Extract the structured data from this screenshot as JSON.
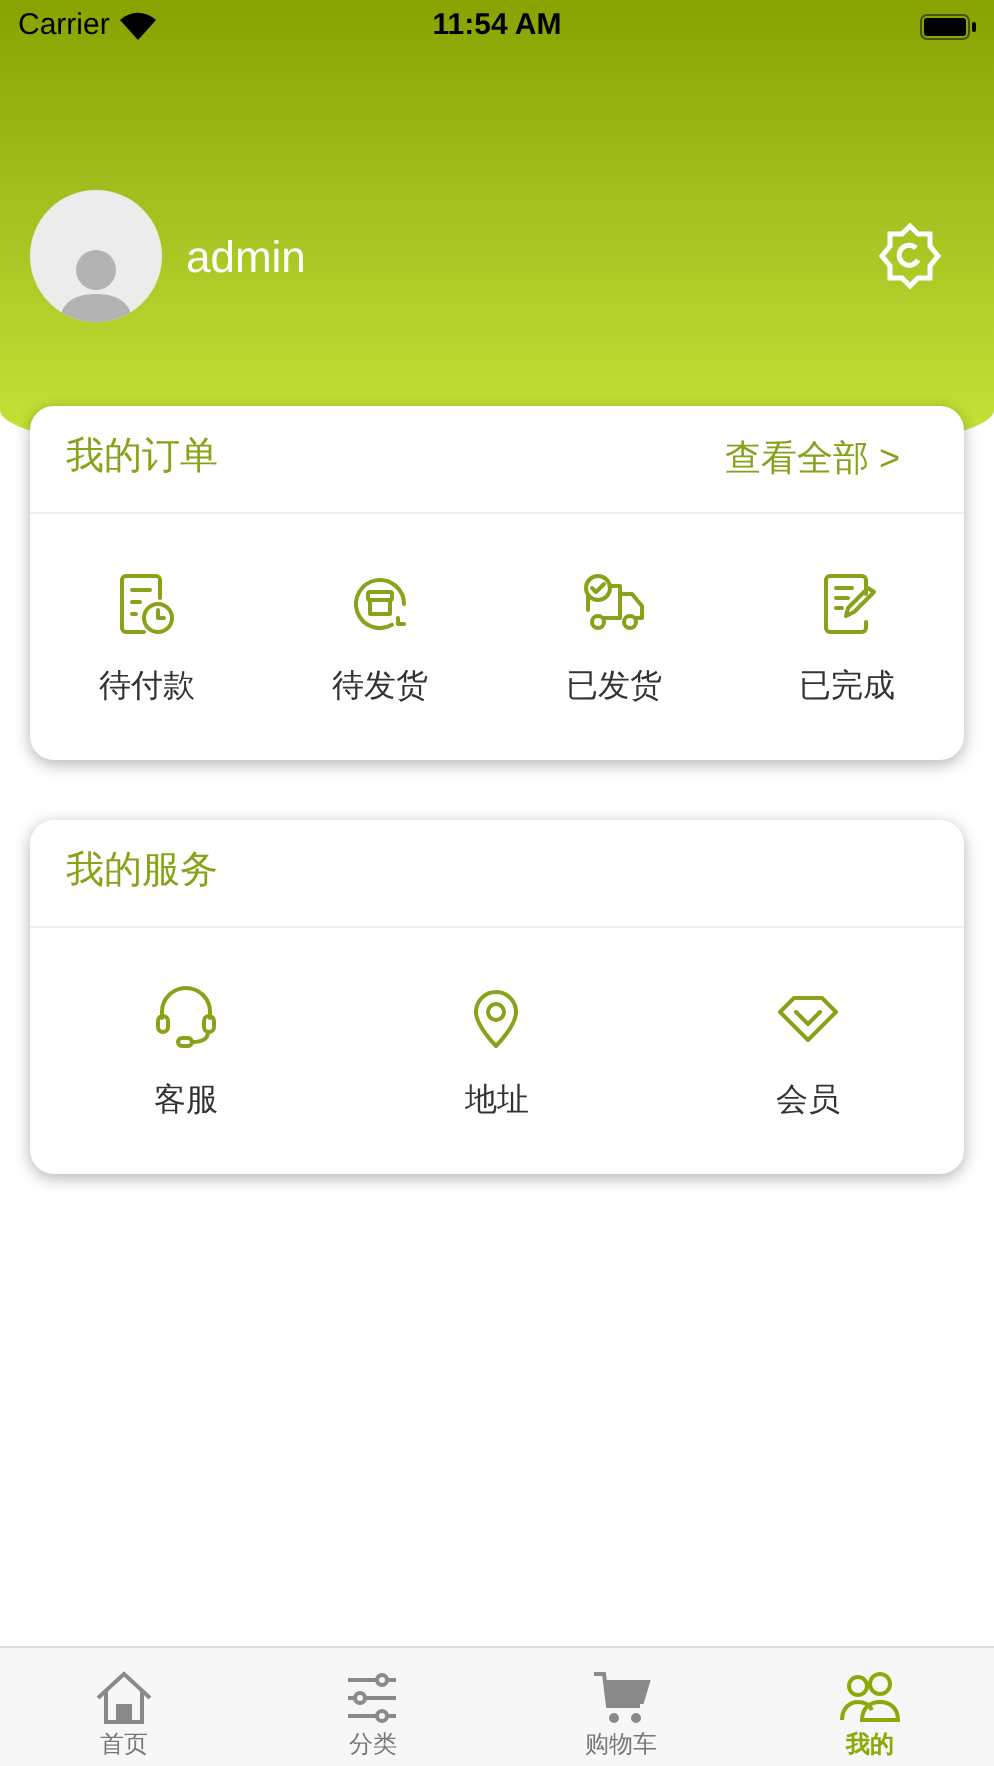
{
  "status_bar": {
    "carrier": "Carrier",
    "time": "11:54 AM"
  },
  "profile": {
    "username": "admin"
  },
  "orders": {
    "title": "我的订单",
    "view_all": "查看全部 >",
    "items": [
      {
        "kind": "payment",
        "label": "待付款"
      },
      {
        "kind": "box",
        "label": "待发货"
      },
      {
        "kind": "truck",
        "label": "已发货"
      },
      {
        "kind": "edit",
        "label": "已完成"
      }
    ]
  },
  "services": {
    "title": "我的服务",
    "items": [
      {
        "kind": "headset",
        "label": "客服"
      },
      {
        "kind": "pin",
        "label": "地址"
      },
      {
        "kind": "diamond",
        "label": "会员"
      }
    ]
  },
  "tab_bar": [
    {
      "kind": "home",
      "label": "首页",
      "selected": false
    },
    {
      "kind": "filters",
      "label": "分类",
      "selected": false
    },
    {
      "kind": "cart",
      "label": "购物车",
      "selected": false
    },
    {
      "kind": "users",
      "label": "我的",
      "selected": true
    }
  ]
}
